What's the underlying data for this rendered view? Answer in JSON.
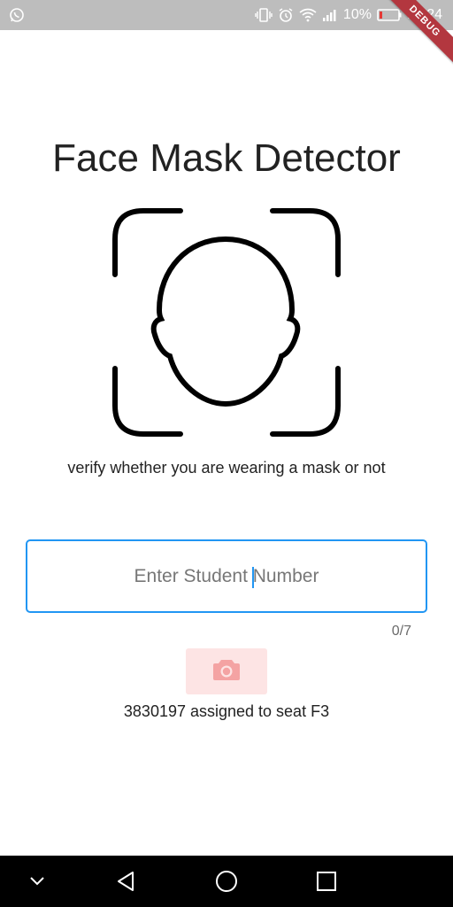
{
  "status_bar": {
    "battery_percent": "10%",
    "time": "17:24",
    "icons": [
      "whatsapp-icon",
      "vibrate-icon",
      "alarm-icon",
      "wifi-icon",
      "signal-icon",
      "battery-icon"
    ]
  },
  "debug_banner": "DEBUG",
  "app": {
    "title": "Face Mask Detector",
    "subtitle": "verify whether you are wearing a mask or not",
    "student_input": {
      "placeholder": "Enter Student Number",
      "value": "",
      "counter": "0/7"
    },
    "capture_button": {
      "icon": "camera-icon"
    },
    "result_text": "3830197 assigned to seat F3"
  },
  "nav_bar": {
    "buttons": [
      "chevron-down-icon",
      "back-icon",
      "home-icon",
      "recents-icon"
    ]
  },
  "colors": {
    "status_bar": "#bdbdbd",
    "accent": "#2196f3",
    "button_bg": "#fde4e4",
    "button_icon": "#f4a3a3",
    "debug_ribbon": "#b3373f",
    "nav_bar": "#000000"
  }
}
